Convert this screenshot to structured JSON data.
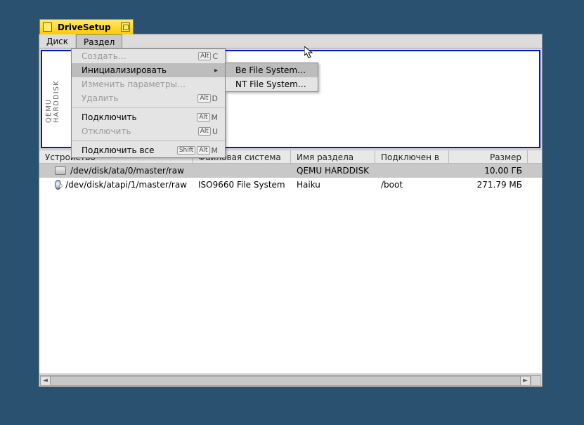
{
  "window": {
    "title": "DriveSetup"
  },
  "menubar": {
    "disk": "Диск",
    "partition": "Раздел"
  },
  "diskmap": {
    "label": "QEMU HARDDISK"
  },
  "headers": {
    "device": "Устройство",
    "fs": "Файловая система",
    "name": "Имя раздела",
    "mount": "Подключен в",
    "size": "Размер"
  },
  "rows": [
    {
      "device": "/dev/disk/ata/0/master/raw",
      "fs": "",
      "name": "QEMU HARDDISK",
      "mount": "",
      "size": "10.00 ГБ",
      "icon": "drive",
      "selected": true
    },
    {
      "device": "/dev/disk/atapi/1/master/raw",
      "fs": "ISO9660 File System",
      "name": "Haiku",
      "mount": "/boot",
      "size": "271.79 МБ",
      "icon": "cd",
      "selected": false
    }
  ],
  "menu": {
    "create": "Создать…",
    "initialize": "Инициализировать",
    "change": "Изменить параметры…",
    "delete": "Удалить",
    "mount": "Подключить",
    "unmount": "Отключить",
    "mount_all": "Подключить все",
    "sc": {
      "alt": "Alt",
      "shift": "Shift",
      "c": "C",
      "d": "D",
      "m": "M",
      "u": "U"
    }
  },
  "submenu": {
    "bfs": "Be File System…",
    "ntfs": "NT File System…"
  }
}
